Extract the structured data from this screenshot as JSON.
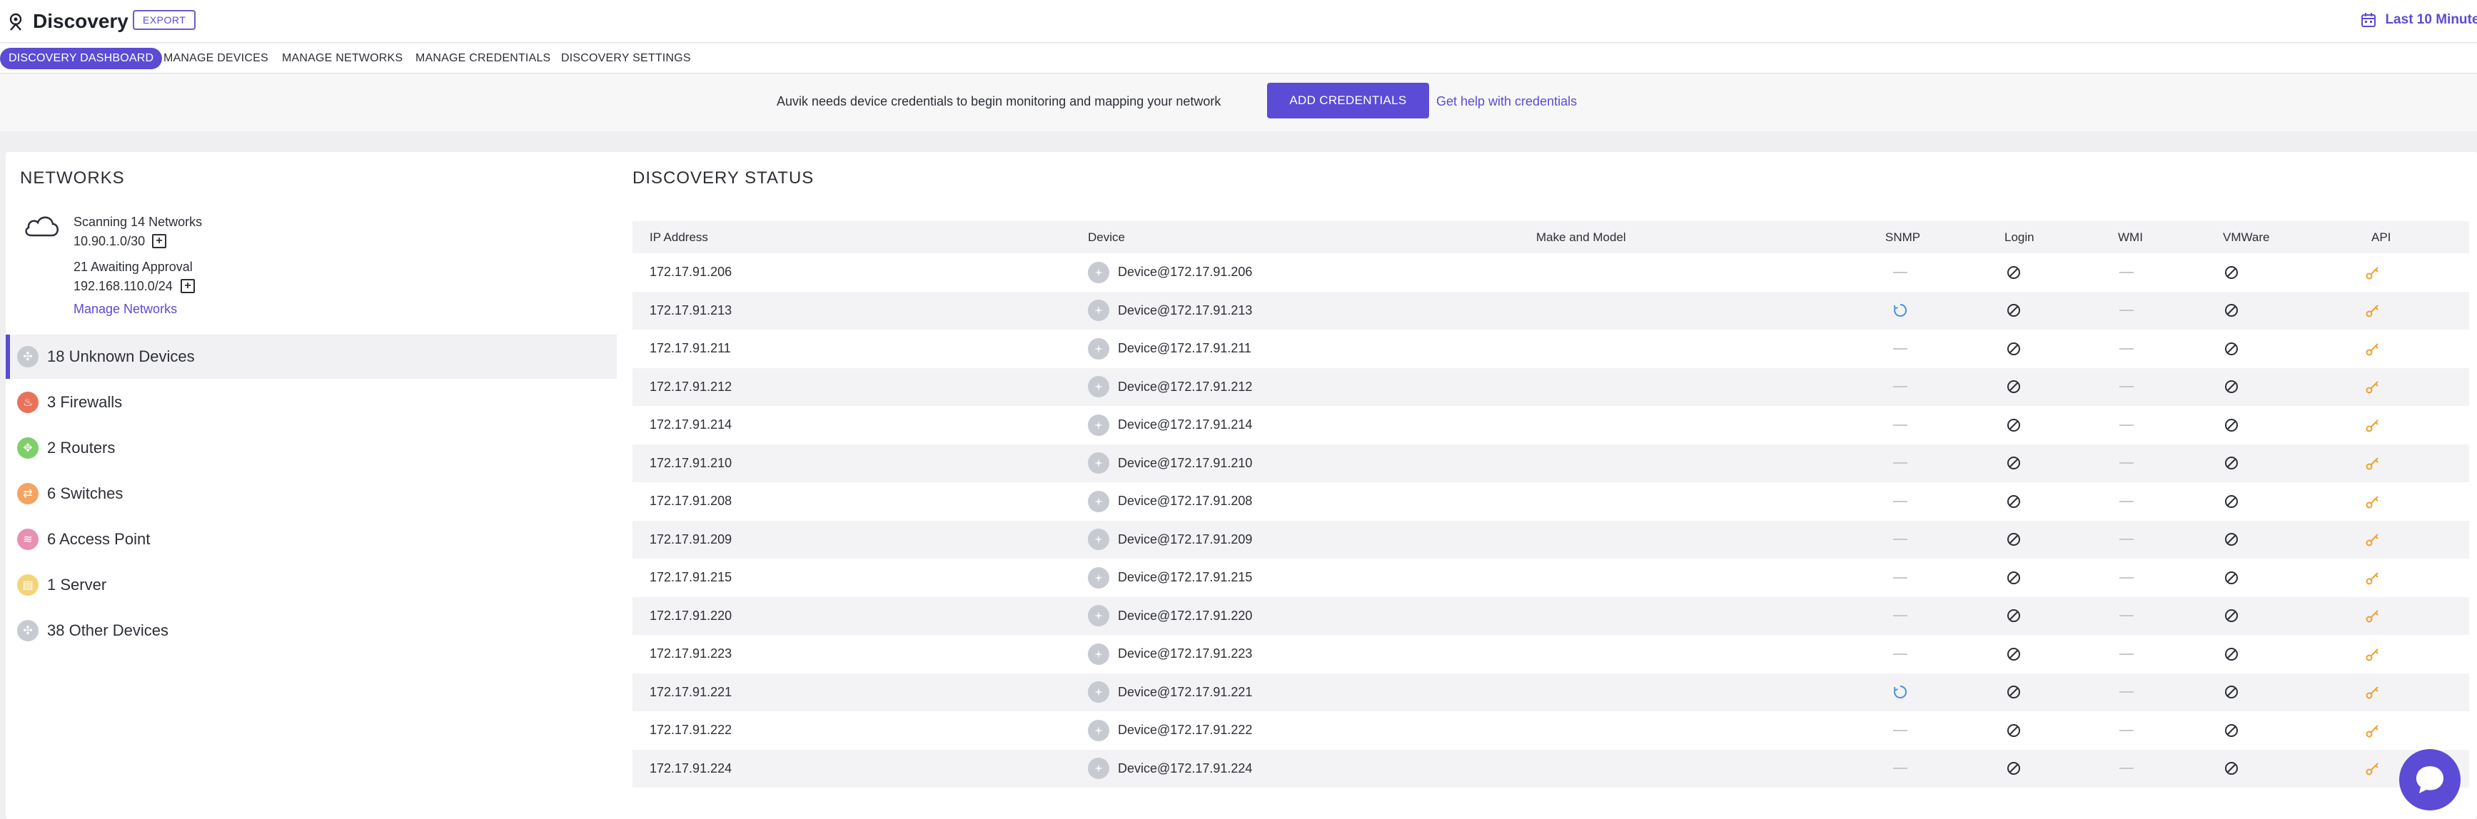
{
  "header": {
    "title": "Discovery",
    "export_label": "EXPORT",
    "time_range": "Last 10 Minutes"
  },
  "tabs": [
    {
      "label": "DISCOVERY DASHBOARD",
      "active": true
    },
    {
      "label": "MANAGE DEVICES"
    },
    {
      "label": "MANAGE NETWORKS"
    },
    {
      "label": "MANAGE CREDENTIALS"
    },
    {
      "label": "DISCOVERY SETTINGS"
    }
  ],
  "banner": {
    "message": "Auvik needs device credentials to begin monitoring and mapping your network",
    "button": "ADD CREDENTIALS",
    "help_link": "Get help with credentials"
  },
  "networks": {
    "title": "NETWORKS",
    "scanning": "Scanning 14 Networks",
    "scanning_subnet": "10.90.1.0/30",
    "awaiting": "21 Awaiting Approval",
    "awaiting_subnet": "192.168.110.0/24",
    "manage_link": "Manage Networks",
    "categories": [
      {
        "label": "18 Unknown Devices",
        "color": "#c8cad2",
        "glyph": "✣"
      },
      {
        "label": "3 Firewalls",
        "color": "#e8735a",
        "glyph": "♨"
      },
      {
        "label": "2 Routers",
        "color": "#7fcf6a",
        "glyph": "✥"
      },
      {
        "label": "6 Switches",
        "color": "#f4a460",
        "glyph": "⇄"
      },
      {
        "label": "6 Access Point",
        "color": "#e98fb4",
        "glyph": "≋"
      },
      {
        "label": "1 Server",
        "color": "#f5d479",
        "glyph": "▤"
      },
      {
        "label": "38 Other Devices",
        "color": "#c8cad2",
        "glyph": "✣"
      }
    ]
  },
  "status": {
    "title": "DISCOVERY STATUS",
    "columns": [
      "IP Address",
      "Device",
      "Make and Model",
      "SNMP",
      "Login",
      "WMI",
      "VMWare",
      "API"
    ],
    "rows": [
      {
        "ip": "172.17.91.206",
        "device": "Device@172.17.91.206",
        "snmp": "dash"
      },
      {
        "ip": "172.17.91.213",
        "device": "Device@172.17.91.213",
        "snmp": "spin"
      },
      {
        "ip": "172.17.91.211",
        "device": "Device@172.17.91.211",
        "snmp": "dash"
      },
      {
        "ip": "172.17.91.212",
        "device": "Device@172.17.91.212",
        "snmp": "dash"
      },
      {
        "ip": "172.17.91.214",
        "device": "Device@172.17.91.214",
        "snmp": "dash"
      },
      {
        "ip": "172.17.91.210",
        "device": "Device@172.17.91.210",
        "snmp": "dash"
      },
      {
        "ip": "172.17.91.208",
        "device": "Device@172.17.91.208",
        "snmp": "dash"
      },
      {
        "ip": "172.17.91.209",
        "device": "Device@172.17.91.209",
        "snmp": "dash"
      },
      {
        "ip": "172.17.91.215",
        "device": "Device@172.17.91.215",
        "snmp": "dash"
      },
      {
        "ip": "172.17.91.220",
        "device": "Device@172.17.91.220",
        "snmp": "dash"
      },
      {
        "ip": "172.17.91.223",
        "device": "Device@172.17.91.223",
        "snmp": "dash"
      },
      {
        "ip": "172.17.91.221",
        "device": "Device@172.17.91.221",
        "snmp": "spin"
      },
      {
        "ip": "172.17.91.222",
        "device": "Device@172.17.91.222",
        "snmp": "dash"
      },
      {
        "ip": "172.17.91.224",
        "device": "Device@172.17.91.224",
        "snmp": "dash"
      }
    ]
  },
  "colors": {
    "accent": "#5b4bd5",
    "key": "#f0a030",
    "spinner": "#4a90e2"
  }
}
